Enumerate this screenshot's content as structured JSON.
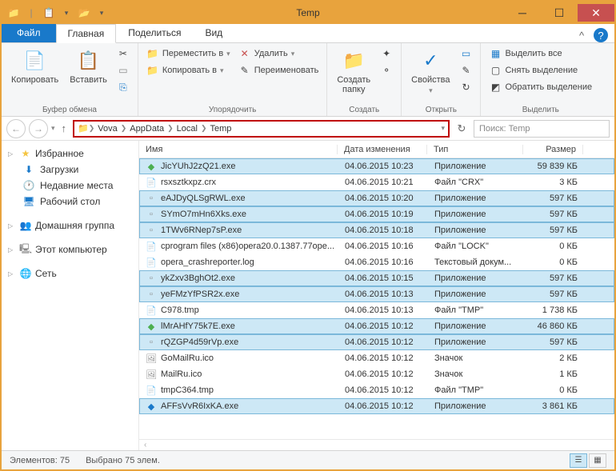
{
  "window": {
    "title": "Temp"
  },
  "tabs": {
    "file": "Файл",
    "home": "Главная",
    "share": "Поделиться",
    "view": "Вид"
  },
  "ribbon": {
    "copy": "Копировать",
    "paste": "Вставить",
    "clipboard_label": "Буфер обмена",
    "move_to": "Переместить в",
    "copy_to": "Копировать в",
    "delete": "Удалить",
    "rename": "Переименовать",
    "organize_label": "Упорядочить",
    "new_folder": "Создать\nпапку",
    "new_label": "Создать",
    "properties": "Свойства",
    "open_label": "Открыть",
    "select_all": "Выделить все",
    "deselect": "Снять выделение",
    "invert": "Обратить выделение",
    "select_label": "Выделить"
  },
  "breadcrumb": [
    "Vova",
    "AppData",
    "Local",
    "Temp"
  ],
  "search_placeholder": "Поиск: Temp",
  "sidebar": {
    "favorites": "Избранное",
    "downloads": "Загрузки",
    "recent": "Недавние места",
    "desktop": "Рабочий стол",
    "homegroup": "Домашняя группа",
    "thispc": "Этот компьютер",
    "network": "Сеть"
  },
  "columns": {
    "name": "Имя",
    "date": "Дата изменения",
    "type": "Тип",
    "size": "Размер"
  },
  "files": [
    {
      "sel": true,
      "icon": "exe-green",
      "name": "JicYUhJ2zQ21.exe",
      "date": "04.06.2015 10:23",
      "type": "Приложение",
      "size": "59 839 КБ"
    },
    {
      "sel": false,
      "icon": "file",
      "name": "rsxsztkxpz.crx",
      "date": "04.06.2015 10:21",
      "type": "Файл \"CRX\"",
      "size": "3 КБ"
    },
    {
      "sel": true,
      "icon": "exe",
      "name": "eAJDyQLSgRWL.exe",
      "date": "04.06.2015 10:20",
      "type": "Приложение",
      "size": "597 КБ"
    },
    {
      "sel": true,
      "icon": "exe",
      "name": "SYmO7mHn6Xks.exe",
      "date": "04.06.2015 10:19",
      "type": "Приложение",
      "size": "597 КБ"
    },
    {
      "sel": true,
      "icon": "exe",
      "name": "1TWv6RNep7sP.exe",
      "date": "04.06.2015 10:18",
      "type": "Приложение",
      "size": "597 КБ"
    },
    {
      "sel": false,
      "icon": "file",
      "name": "cprogram files (x86)opera20.0.1387.77ope...",
      "date": "04.06.2015 10:16",
      "type": "Файл \"LOCK\"",
      "size": "0 КБ"
    },
    {
      "sel": false,
      "icon": "file",
      "name": "opera_crashreporter.log",
      "date": "04.06.2015 10:16",
      "type": "Текстовый докум...",
      "size": "0 КБ"
    },
    {
      "sel": true,
      "icon": "exe",
      "name": "ykZxv3BghOt2.exe",
      "date": "04.06.2015 10:15",
      "type": "Приложение",
      "size": "597 КБ"
    },
    {
      "sel": true,
      "icon": "exe",
      "name": "yeFMzYfPSR2x.exe",
      "date": "04.06.2015 10:13",
      "type": "Приложение",
      "size": "597 КБ"
    },
    {
      "sel": false,
      "icon": "file",
      "name": "C978.tmp",
      "date": "04.06.2015 10:13",
      "type": "Файл \"TMP\"",
      "size": "1 738 КБ"
    },
    {
      "sel": true,
      "icon": "exe-green",
      "name": "lMrAHfY75k7E.exe",
      "date": "04.06.2015 10:12",
      "type": "Приложение",
      "size": "46 860 КБ"
    },
    {
      "sel": true,
      "icon": "exe",
      "name": "rQZGP4d59rVp.exe",
      "date": "04.06.2015 10:12",
      "type": "Приложение",
      "size": "597 КБ"
    },
    {
      "sel": false,
      "icon": "ico",
      "name": "GoMailRu.ico",
      "date": "04.06.2015 10:12",
      "type": "Значок",
      "size": "2 КБ"
    },
    {
      "sel": false,
      "icon": "ico",
      "name": "MailRu.ico",
      "date": "04.06.2015 10:12",
      "type": "Значок",
      "size": "1 КБ"
    },
    {
      "sel": false,
      "icon": "file",
      "name": "tmpC364.tmp",
      "date": "04.06.2015 10:12",
      "type": "Файл \"TMP\"",
      "size": "0 КБ"
    },
    {
      "sel": true,
      "icon": "exe-blue",
      "name": "AFFsVvR6IxKA.exe",
      "date": "04.06.2015 10:12",
      "type": "Приложение",
      "size": "3 861 КБ"
    }
  ],
  "status": {
    "items": "Элементов: 75",
    "selected": "Выбрано 75 элем."
  }
}
